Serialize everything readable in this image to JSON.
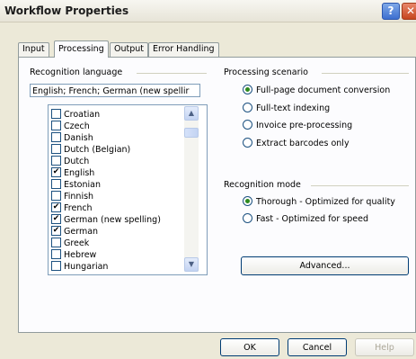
{
  "window": {
    "title": "Workflow Properties",
    "help_glyph": "?",
    "close_glyph": "✕"
  },
  "tabs": [
    {
      "label": "Input"
    },
    {
      "label": "Processing"
    },
    {
      "label": "Output"
    },
    {
      "label": "Error Handling"
    }
  ],
  "recognition_language": {
    "label": "Recognition language",
    "selected_value": "English; French; German (new spellir",
    "items": [
      {
        "label": "Croatian",
        "checked": false
      },
      {
        "label": "Czech",
        "checked": false
      },
      {
        "label": "Danish",
        "checked": false
      },
      {
        "label": "Dutch (Belgian)",
        "checked": false
      },
      {
        "label": "Dutch",
        "checked": false
      },
      {
        "label": "English",
        "checked": true
      },
      {
        "label": "Estonian",
        "checked": false
      },
      {
        "label": "Finnish",
        "checked": false
      },
      {
        "label": "French",
        "checked": true
      },
      {
        "label": "German (new spelling)",
        "checked": true
      },
      {
        "label": "German",
        "checked": true
      },
      {
        "label": "Greek",
        "checked": false
      },
      {
        "label": "Hebrew",
        "checked": false
      },
      {
        "label": "Hungarian",
        "checked": false
      }
    ]
  },
  "processing_scenario": {
    "label": "Processing scenario",
    "options": [
      {
        "label": "Full-page document conversion",
        "selected": true
      },
      {
        "label": "Full-text indexing",
        "selected": false
      },
      {
        "label": "Invoice pre-processing",
        "selected": false
      },
      {
        "label": "Extract barcodes only",
        "selected": false
      }
    ]
  },
  "recognition_mode": {
    "label": "Recognition mode",
    "options": [
      {
        "label": "Thorough - Optimized for quality",
        "selected": true
      },
      {
        "label": "Fast - Optimized for speed",
        "selected": false
      }
    ]
  },
  "buttons": {
    "advanced": "Advanced...",
    "ok": "OK",
    "cancel": "Cancel",
    "help": "Help"
  },
  "icons": {
    "scroll_up": "▲",
    "scroll_down": "▼",
    "check": "✔"
  }
}
